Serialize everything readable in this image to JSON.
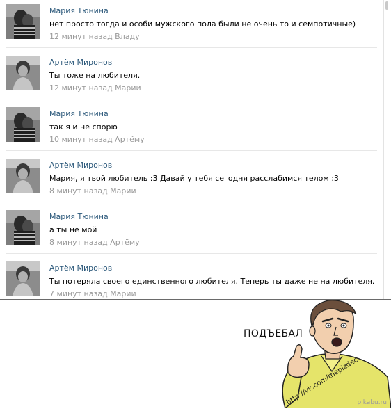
{
  "comments": [
    {
      "author": "Мария Тюнина",
      "text": "нет просто тогда и особи мужского пола были не очень то и семпотичные)",
      "meta": "12 минут назад Владу",
      "avatar": "maria"
    },
    {
      "author": "Артём Миронов",
      "text": "Ты тоже на любителя.",
      "meta": "12 минут назад Марии",
      "avatar": "artem"
    },
    {
      "author": "Мария Тюнина",
      "text": "так я и не спорю",
      "meta": "10 минут назад Артёму",
      "avatar": "maria"
    },
    {
      "author": "Артём Миронов",
      "text": "Мария, я твой любитель :3 Давай у тебя сегодня расслабимся телом :3",
      "meta": "8 минут назад Марии",
      "avatar": "artem"
    },
    {
      "author": "Мария Тюнина",
      "text": "а ты не мой",
      "meta": "8 минут назад Артёму",
      "avatar": "maria"
    },
    {
      "author": "Артём Миронов",
      "text": "Ты потеряла своего единственного любителя. Теперь ты даже не на любителя.",
      "meta": "7 минут назад Марии",
      "avatar": "artem"
    }
  ],
  "meme": {
    "caption": "ПОДЪЕБАЛ",
    "shirt_text": "http://vk.com/thepizdec",
    "watermark": "pikabu.ru"
  },
  "colors": {
    "author_link": "#2b587a",
    "meta_text": "#999999",
    "separator": "#e7e7e7",
    "shirt": "#e5e46a"
  }
}
